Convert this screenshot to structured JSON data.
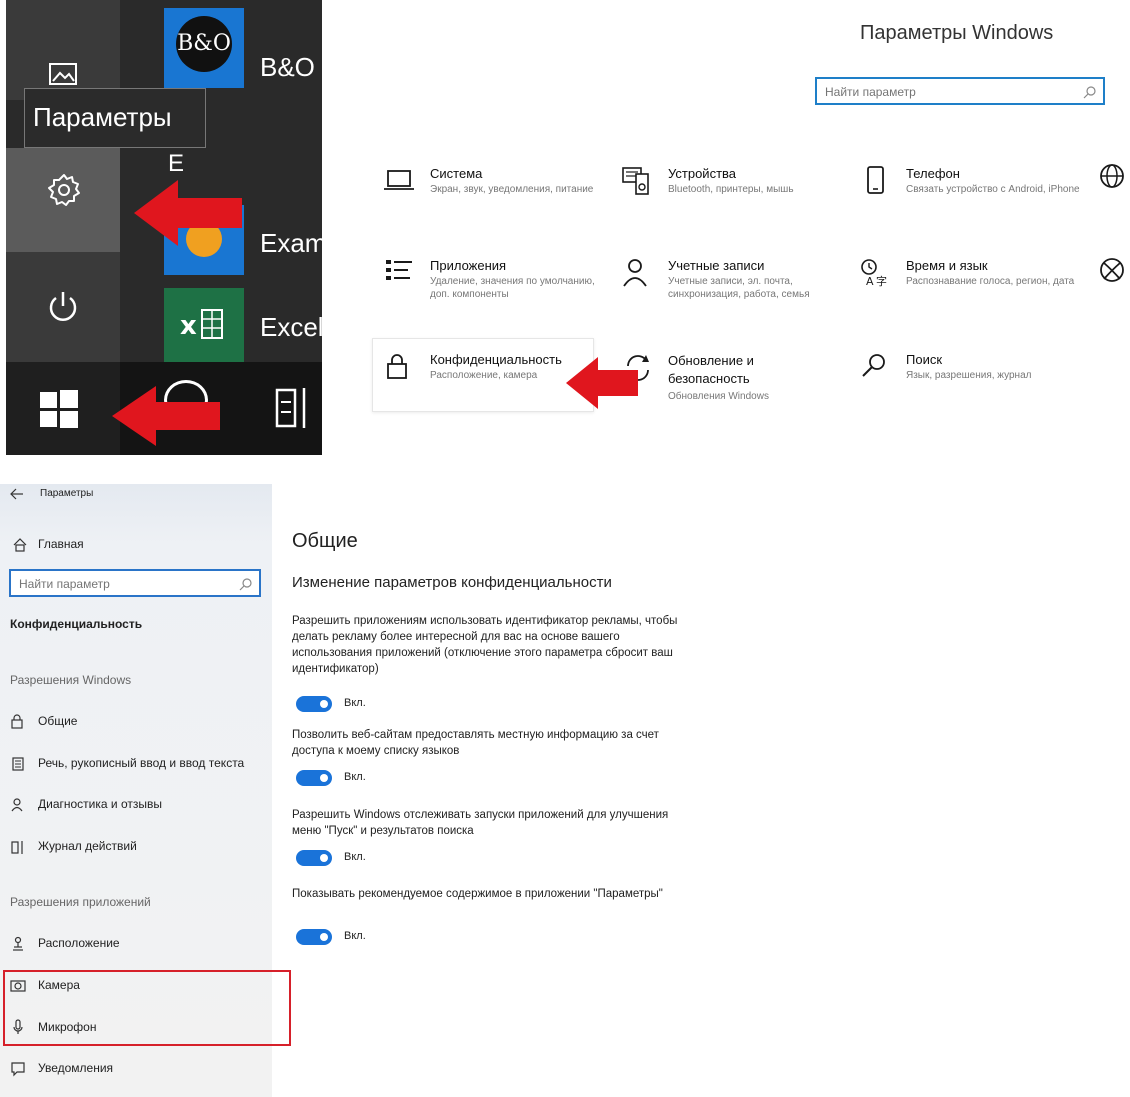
{
  "start_menu": {
    "tooltip": "Параметры",
    "tiles": {
      "bo": "B&O",
      "exam": "Exam",
      "excel": "Excel",
      "letter_e": "E"
    },
    "colors": {
      "panel": "#2a2a2a",
      "arrow": "#e0161e",
      "tile_blue": "#1976d2",
      "tile_green": "#1e7145"
    }
  },
  "settings_home": {
    "title": "Параметры Windows",
    "search_placeholder": "Найти параметр",
    "categories": [
      {
        "title": "Система",
        "desc": "Экран, звук, уведомления, питание",
        "icon": "laptop-icon"
      },
      {
        "title": "Устройства",
        "desc": "Bluetooth, принтеры, мышь",
        "icon": "devices-icon"
      },
      {
        "title": "Телефон",
        "desc": "Связать устройство с Android, iPhone",
        "icon": "phone-icon"
      },
      {
        "title": "Приложения",
        "desc": "Удаление, значения по умолчанию, доп. компоненты",
        "icon": "apps-list-icon"
      },
      {
        "title": "Учетные записи",
        "desc": "Учетные записи, эл. почта, синхронизация, работа, семья",
        "icon": "person-icon"
      },
      {
        "title": "Время и язык",
        "desc": "Распознавание голоса, регион, дата",
        "icon": "time-language-icon"
      },
      {
        "title": "Конфиденциальность",
        "desc": "Расположение, камера",
        "icon": "lock-icon"
      },
      {
        "title": "Обновление и безопасность",
        "desc": "Обновления Windows",
        "icon": "update-icon"
      },
      {
        "title": "Поиск",
        "desc": "Язык, разрешения, журнал",
        "icon": "search-icon"
      }
    ]
  },
  "privacy": {
    "window_title": "Параметры",
    "home": "Главная",
    "search_placeholder": "Найти параметр",
    "section": "Конфиденциальность",
    "group_windows": "Разрешения Windows",
    "windows_items": [
      "Общие",
      "Речь, рукописный ввод и ввод текста",
      "Диагностика и отзывы",
      "Журнал действий"
    ],
    "group_apps": "Разрешения приложений",
    "app_items": [
      "Расположение",
      "Камера",
      "Микрофон",
      "Уведомления"
    ],
    "page_title": "Общие",
    "page_subtitle": "Изменение параметров конфиденциальности",
    "settings": [
      {
        "desc": "Разрешить приложениям использовать идентификатор рекламы, чтобы делать рекламу более интересной для вас на основе вашего использования приложений (отключение этого параметра сбросит ваш идентификатор)",
        "state": "Вкл."
      },
      {
        "desc": "Позволить веб-сайтам предоставлять местную информацию за счет доступа к моему списку языков",
        "state": "Вкл."
      },
      {
        "desc": "Разрешить Windows отслеживать запуски приложений для улучшения меню \"Пуск\" и результатов поиска",
        "state": "Вкл."
      },
      {
        "desc": "Показывать рекомендуемое содержимое в приложении \"Параметры\"",
        "state": "Вкл."
      }
    ],
    "colors": {
      "toggle_on": "#1a73d9",
      "highlight": "#d6202a"
    }
  }
}
